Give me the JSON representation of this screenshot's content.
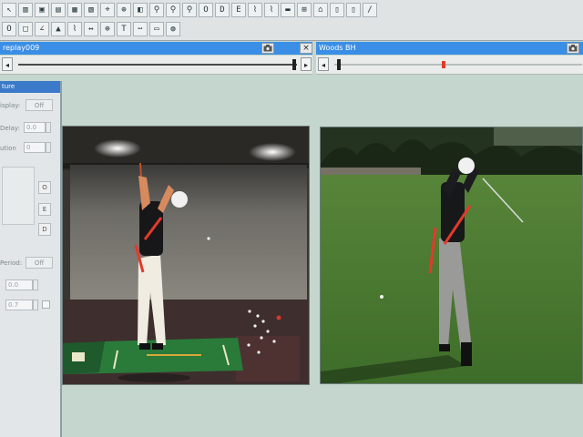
{
  "colors": {
    "title_bar": "#3a8ee6",
    "desktop": "#c4d6cd",
    "toolbar": "#dfe3e4",
    "swing_line": "#e23a2a"
  },
  "toolbar": {
    "row1_glyphs": [
      "↖",
      "▥",
      "▣",
      "▤",
      "▦",
      "▧",
      "⌖",
      "⊕",
      "◧",
      "⚲",
      "⚲",
      "⚲",
      "O",
      "D",
      "E",
      "⌇",
      "⌇",
      "▬",
      "⊞",
      "⌂",
      "▯",
      "▯",
      "∕"
    ],
    "row2_glyphs": [
      "O",
      "□",
      "∠",
      "▲",
      "⌇",
      "↔",
      "⊕",
      "T",
      "⋯",
      "▭",
      "◍"
    ]
  },
  "left_window": {
    "title": "replay009",
    "icon": "camera-icon",
    "close_glyph": "×",
    "prev_glyph": "◂",
    "next_glyph": "▸",
    "position": 0.99
  },
  "right_window": {
    "title": "Woods BH",
    "icon": "camera-icon",
    "prev_glyph": "◂",
    "position": 0.02,
    "marker": 0.44
  },
  "panel": {
    "title": "ture",
    "display_label": "isplay:",
    "display_value": "Off",
    "delay_label": "Delay:",
    "delay_value": "0.0",
    "option_label": "ution",
    "option_value": "0",
    "button_o": "O",
    "button_e": "E",
    "button_d": "D",
    "period_label": "Period:",
    "period_value": "Off",
    "field1_value": "0.0",
    "field2_value": "0.7"
  }
}
